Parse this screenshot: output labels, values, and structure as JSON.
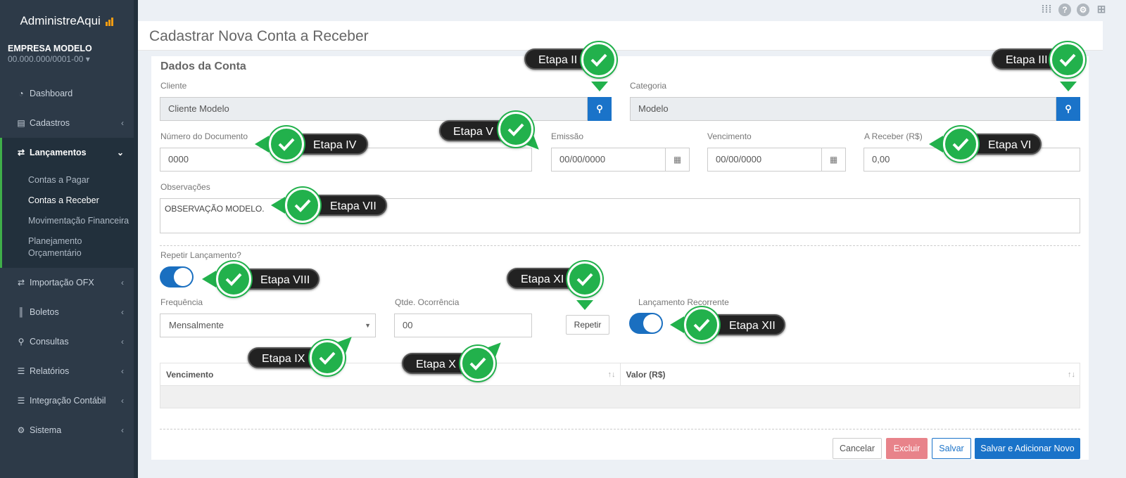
{
  "brand": {
    "name": "AdministreAqui"
  },
  "company": {
    "name": "EMPRESA MODELO",
    "cnpj": "00.000.000/0001-00"
  },
  "nav": {
    "dashboard": "Dashboard",
    "cadastros": "Cadastros",
    "lancamentos": "Lançamentos",
    "sub": [
      "Contas a Pagar",
      "Contas a Receber",
      "Movimentação Financeira",
      "Planejamento Orçamentário"
    ],
    "importacao": "Importação OFX",
    "boletos": "Boletos",
    "consultas": "Consultas",
    "relatorios": "Relatórios",
    "integracao": "Integração Contábil",
    "sistema": "Sistema"
  },
  "topbar": {
    "help": "?"
  },
  "page": {
    "title": "Cadastrar Nova Conta a Receber"
  },
  "form": {
    "section_title": "Dados da Conta",
    "cliente_label": "Cliente",
    "cliente_value": "Cliente Modelo",
    "categoria_label": "Categoria",
    "categoria_value": "Modelo",
    "numero_label": "Número do Documento",
    "numero_value": "0000",
    "emissao_label": "Emissão",
    "emissao_value": "00/00/0000",
    "vencimento_label": "Vencimento",
    "vencimento_value": "00/00/0000",
    "receber_label": "A Receber (R$)",
    "receber_value": "0,00",
    "obs_label": "Observações",
    "obs_value": "OBSERVAÇÃO MODELO.",
    "repetir_label": "Repetir Lançamento?",
    "frequencia_label": "Frequência",
    "frequencia_value": "Mensalmente",
    "qtde_label": "Qtde. Ocorrência",
    "qtde_value": "00",
    "repetir_button": "Repetir",
    "recorrente_label": "Lançamento Recorrente"
  },
  "table": {
    "columns": [
      "Vencimento",
      "Valor (R$)"
    ]
  },
  "actions": {
    "cancel": "Cancelar",
    "delete": "Excluir",
    "save": "Salvar",
    "save_new": "Salvar e Adicionar Novo"
  },
  "steps": [
    "Etapa II",
    "Etapa III",
    "Etapa IV",
    "Etapa V",
    "Etapa VI",
    "Etapa VII",
    "Etapa VIII",
    "Etapa IX",
    "Etapa X",
    "Etapa XI",
    "Etapa XII"
  ],
  "colors": {
    "sidebar": "#2d3a48",
    "accent_green": "#3fae49",
    "primary": "#1a73c9",
    "danger": "#e8838a",
    "step_check": "#22b14c"
  }
}
